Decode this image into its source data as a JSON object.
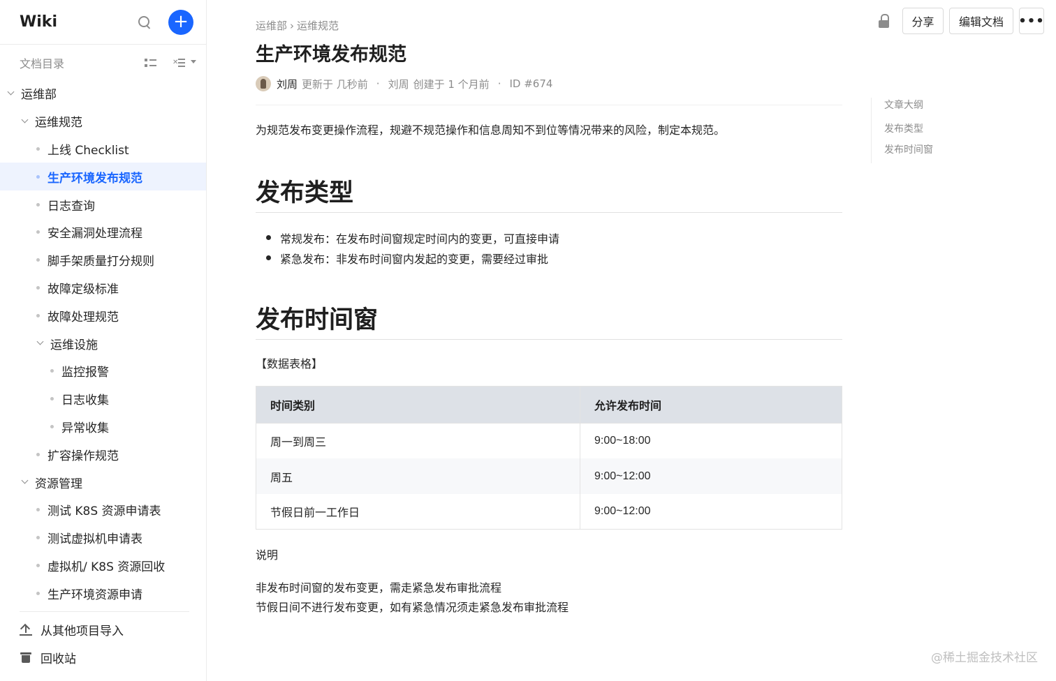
{
  "sidebar": {
    "title": "Wiki",
    "add_label": "+",
    "toc_label": "文档目录",
    "tree": [
      {
        "label": "运维部",
        "level": 0,
        "type": "folder"
      },
      {
        "label": "运维规范",
        "level": 1,
        "type": "folder"
      },
      {
        "label": "上线 Checklist",
        "level": 2,
        "type": "doc"
      },
      {
        "label": "生产环境发布规范",
        "level": 2,
        "type": "doc",
        "active": true
      },
      {
        "label": "日志查询",
        "level": 2,
        "type": "doc"
      },
      {
        "label": "安全漏洞处理流程",
        "level": 2,
        "type": "doc"
      },
      {
        "label": "脚手架质量打分规则",
        "level": 2,
        "type": "doc"
      },
      {
        "label": "故障定级标准",
        "level": 2,
        "type": "doc"
      },
      {
        "label": "故障处理规范",
        "level": 2,
        "type": "doc"
      },
      {
        "label": "运维设施",
        "level": 2,
        "type": "folder"
      },
      {
        "label": "监控报警",
        "level": 3,
        "type": "doc"
      },
      {
        "label": "日志收集",
        "level": 3,
        "type": "doc"
      },
      {
        "label": "异常收集",
        "level": 3,
        "type": "doc"
      },
      {
        "label": "扩容操作规范",
        "level": 2,
        "type": "doc"
      },
      {
        "label": "资源管理",
        "level": 1,
        "type": "folder"
      },
      {
        "label": "测试 K8S 资源申请表",
        "level": 2,
        "type": "doc"
      },
      {
        "label": "测试虚拟机申请表",
        "level": 2,
        "type": "doc"
      },
      {
        "label": "虚拟机/ K8S 资源回收",
        "level": 2,
        "type": "doc"
      },
      {
        "label": "生产环境资源申请",
        "level": 2,
        "type": "doc"
      }
    ],
    "import_label": "从其他项目导入",
    "trash_label": "回收站"
  },
  "toolbar": {
    "share_label": "分享",
    "edit_label": "编辑文档",
    "more_label": "•••"
  },
  "doc": {
    "breadcrumb": [
      "运维部",
      "运维规范"
    ],
    "breadcrumb_sep": "›",
    "title": "生产环境发布规范",
    "author": "刘周",
    "updated": "更新于 几秒前",
    "creator": "刘周",
    "created": "创建于 1 个月前",
    "id": "ID #674",
    "meta_dot": "·",
    "intro": "为规范发布变更操作流程，规避不规范操作和信息周知不到位等情况带来的风险，制定本规范。",
    "section1_title": "发布类型",
    "bullets": [
      "常规发布：在发布时间窗规定时间内的变更，可直接申请",
      "紧急发布：非发布时间窗内发起的变更，需要经过审批"
    ],
    "section2_title": "发布时间窗",
    "table_caption": "【数据表格】",
    "table": {
      "headers": [
        "时间类别",
        "允许发布时间"
      ],
      "rows": [
        [
          "周一到周三",
          "9:00~18:00"
        ],
        [
          "周五",
          "9:00~12:00"
        ],
        [
          "节假日前一工作日",
          "9:00~12:00"
        ]
      ]
    },
    "note_title": "说明",
    "notes": [
      "非发布时间窗的发布变更，需走紧急发布审批流程",
      "节假日间不进行发布变更，如有紧急情况须走紧急发布审批流程"
    ]
  },
  "outline": {
    "title": "文章大纲",
    "items": [
      "发布类型",
      "发布时间窗"
    ]
  },
  "watermark": "@稀土掘金技术社区",
  "colors": {
    "accent": "#1a66ff",
    "active_bg": "#eef3fe",
    "table_header_bg": "#dde1e7"
  }
}
